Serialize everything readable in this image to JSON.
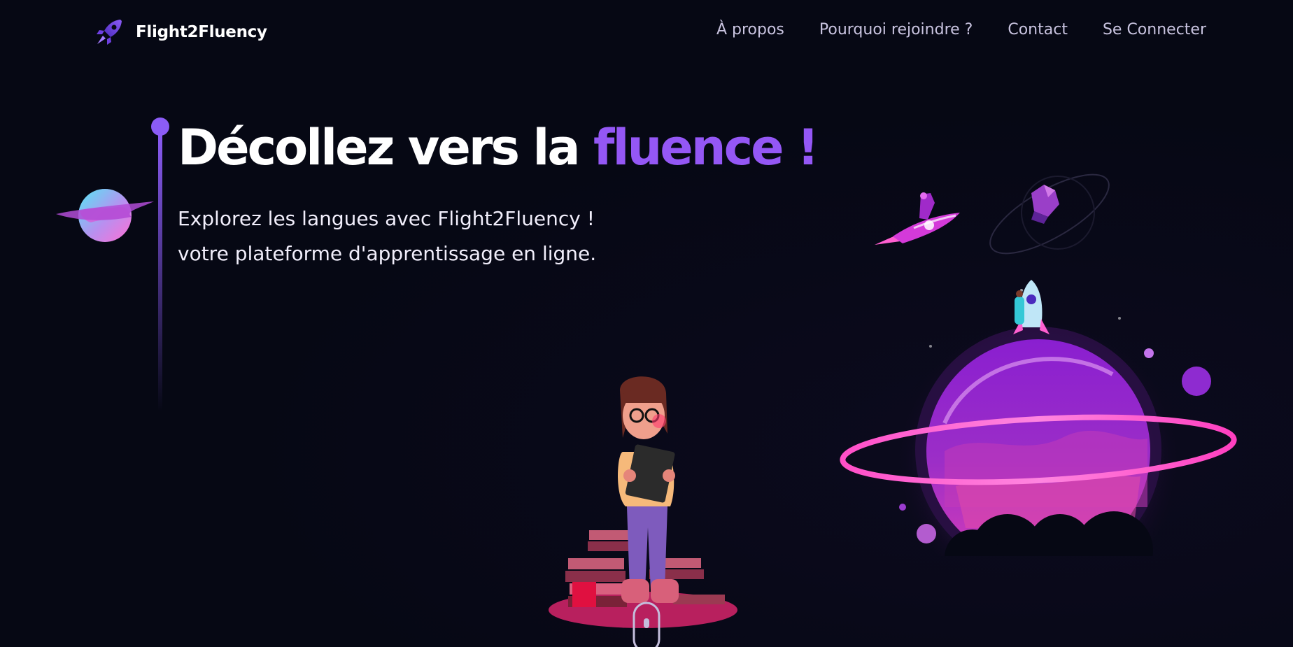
{
  "header": {
    "logo_text": "Flight2Fluency",
    "logo_icon": "rocket-icon",
    "nav": [
      {
        "label": "À propos"
      },
      {
        "label": "Pourquoi rejoindre ?"
      },
      {
        "label": "Contact"
      },
      {
        "label": "Se Connecter"
      }
    ]
  },
  "hero": {
    "title_main": "Décollez vers la ",
    "title_accent": "fluence !",
    "subtitle_line1": "Explorez les langues avec Flight2Fluency !",
    "subtitle_line2": "votre plateforme d'apprentissage en ligne."
  },
  "colors": {
    "background": "#060814",
    "accent": "#9457f5",
    "nav_text": "#c9c4e0",
    "planet_pink": "#ff4fc8",
    "planet_purple": "#8a1fd0"
  },
  "icons": {
    "small_planet": "planet-icon",
    "flying_rocket": "rocket-with-person-icon",
    "asteroid_orbit": "asteroid-icon",
    "big_planet": "ringed-planet-icon",
    "girl_reading": "girl-reading-illustration",
    "scroll_indicator": "mouse-scroll-icon"
  }
}
